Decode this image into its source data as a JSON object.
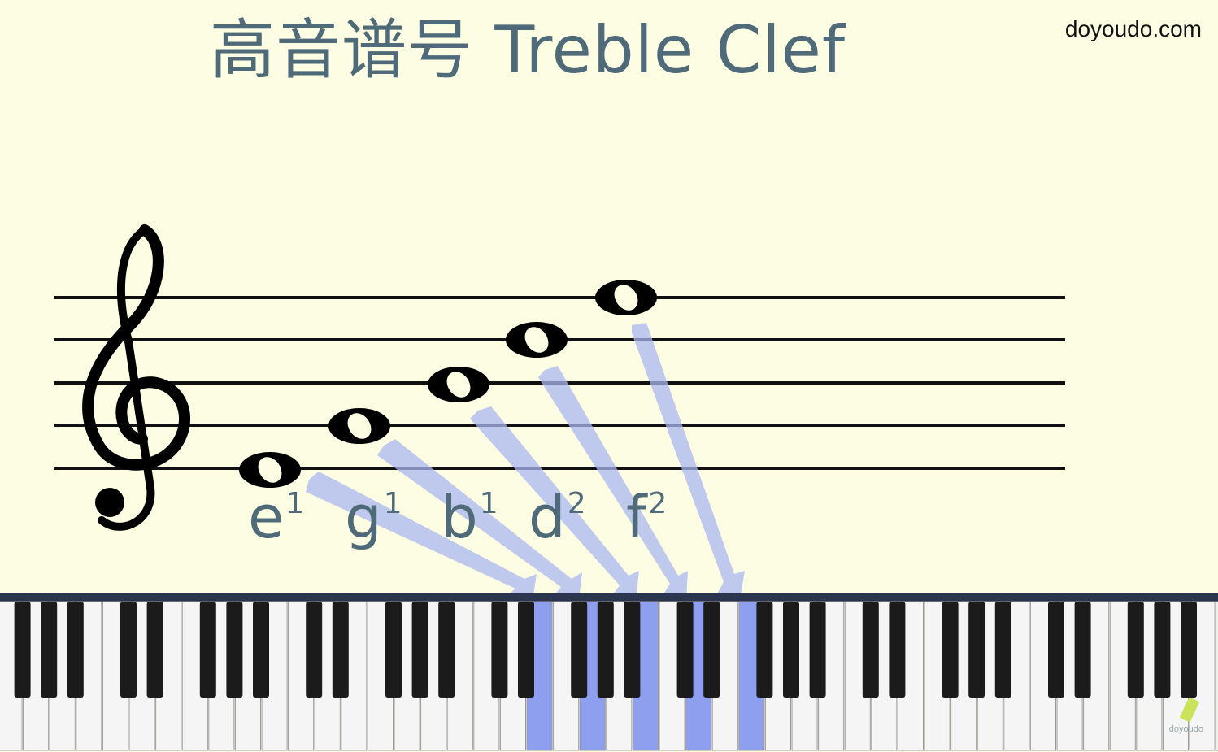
{
  "title": "高音谱号 Treble Clef",
  "brand": "doyoudo.com",
  "watermark": "doyoudo",
  "notes": [
    {
      "letter": "e",
      "octave": "1",
      "label_x": 305
    },
    {
      "letter": "g",
      "octave": "1",
      "label_x": 424
    },
    {
      "letter": "b",
      "octave": "1",
      "label_x": 542
    },
    {
      "letter": "d",
      "octave": "2",
      "label_x": 650
    },
    {
      "letter": "f",
      "octave": "2",
      "label_x": 770
    }
  ],
  "colors": {
    "background": "#fdfde3",
    "title": "#4f6a78",
    "highlight": "#8f9ff0",
    "arrow": "#a9b7f0"
  },
  "icons": [
    "treble-clef-icon",
    "pencil-icon"
  ]
}
